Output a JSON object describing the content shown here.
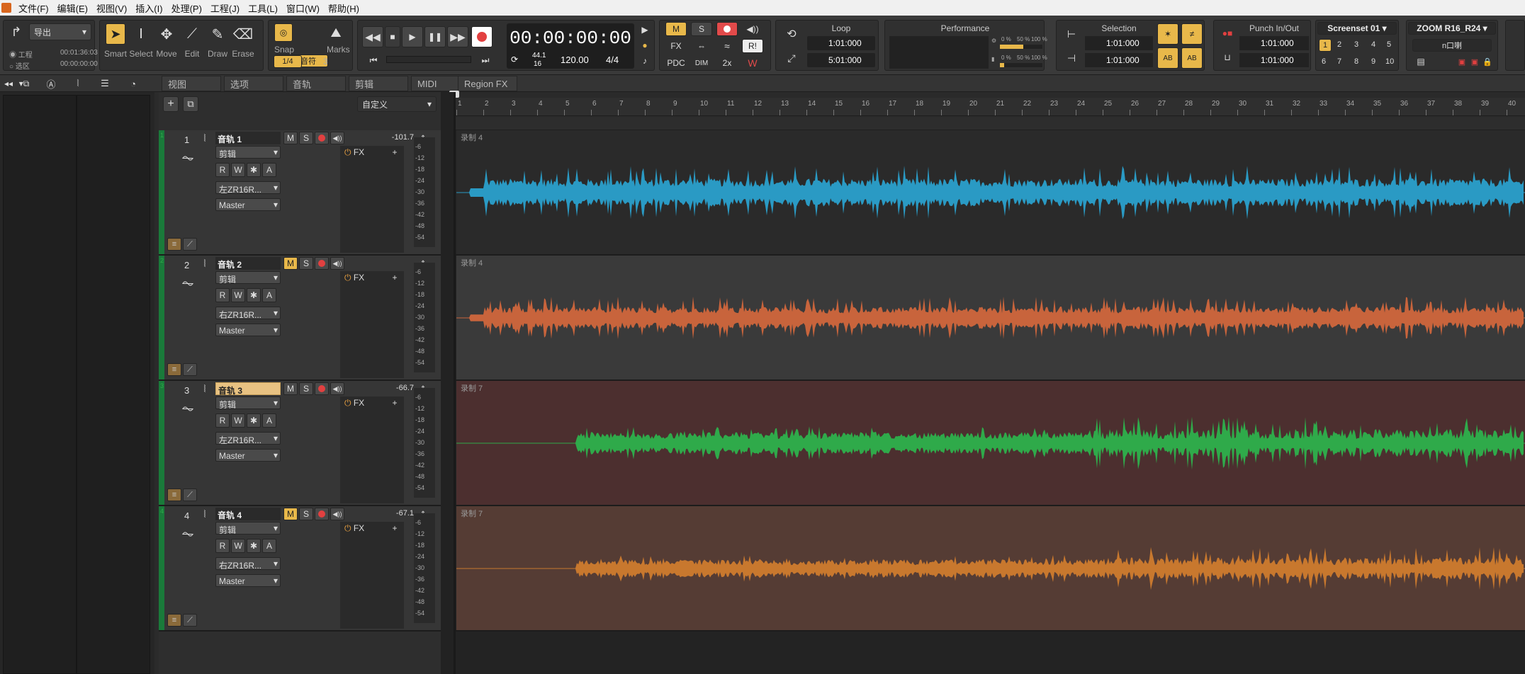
{
  "menu": [
    "文件(F)",
    "编辑(E)",
    "视图(V)",
    "插入(I)",
    "处理(P)",
    "工程(J)",
    "工具(L)",
    "窗口(W)",
    "帮助(H)"
  ],
  "export": {
    "label": "导出",
    "project_label": "工程",
    "region_label": "选区",
    "time1": "00:01:36:03",
    "time2": "00:00:00:00"
  },
  "tools": [
    {
      "label": "Smart",
      "icon": "arrow-icon"
    },
    {
      "label": "Select",
      "icon": "ibeam-icon"
    },
    {
      "label": "Move",
      "icon": "move-icon"
    },
    {
      "label": "Edit",
      "icon": "edit-icon"
    },
    {
      "label": "Draw",
      "icon": "pencil-icon"
    },
    {
      "label": "Erase",
      "icon": "eraser-icon"
    }
  ],
  "snap": {
    "label": "Snap",
    "value": "4 分音符",
    "quant": "1/4",
    "n": "3",
    "marks": "Marks"
  },
  "transport": {
    "time": "00:00:00:00",
    "rate": "44.1",
    "bits": "16",
    "tempo": "120.00",
    "meter": "4/4"
  },
  "mix": {
    "m": "M",
    "s": "S",
    "fx": "FX",
    "ri": "R!",
    "pdc": "PDC",
    "dim": "DIM",
    "x2": "2x"
  },
  "loop": {
    "title": "Loop",
    "start": "1:01:000",
    "end": "5:01:000"
  },
  "performance": {
    "title": "Performance",
    "p1": "0 %",
    "p2": "50 %",
    "p3": "100 %"
  },
  "selection": {
    "title": "Selection",
    "start": "1:01:000",
    "end": "1:01:000"
  },
  "punch": {
    "title": "Punch In/Out",
    "start": "1:01:000",
    "end": "1:01:000"
  },
  "screenset": {
    "title": "Screenset 01",
    "nums": [
      "1",
      "2",
      "3",
      "4",
      "5",
      "6",
      "7",
      "8",
      "9",
      "10"
    ]
  },
  "device": {
    "title": "ZOOM R16_R24",
    "sub": "n口喇"
  },
  "tabs": [
    "视图",
    "选项",
    "音轨",
    "剪辑",
    "MIDI",
    "Region FX"
  ],
  "preset": "自定义",
  "meter_marks": [
    "-6",
    "-12",
    "-18",
    "-24",
    "-30",
    "-36",
    "-42",
    "-48",
    "-54"
  ],
  "ruler": [
    "1",
    "2",
    "3",
    "4",
    "5",
    "6",
    "7",
    "8",
    "9",
    "10",
    "11",
    "12",
    "13",
    "14",
    "15",
    "16",
    "17",
    "18",
    "19",
    "20",
    "21",
    "22",
    "23",
    "24",
    "25",
    "26",
    "27",
    "28",
    "29",
    "30",
    "31",
    "32",
    "33",
    "34",
    "35",
    "36",
    "37",
    "38",
    "39",
    "40"
  ],
  "colors": {
    "track1": "#2a9ac4",
    "track2": "#c8643c",
    "track3": "#2faa4a",
    "track4": "#c8782e",
    "bg1": "#2a2a2a",
    "bg2": "#3a3a3a",
    "bg3": "#4c2f2f",
    "bg4": "#553c34"
  },
  "tracks": [
    {
      "num": "1",
      "name": "音轨 1",
      "clip": "剪辑",
      "input": "左ZR16R...",
      "out": "Master",
      "fx": "FX",
      "vol": "-101.7",
      "clipname": "录制 4",
      "mute_on": false,
      "sel": false
    },
    {
      "num": "2",
      "name": "音轨 2",
      "clip": "剪辑",
      "input": "右ZR16R...",
      "out": "Master",
      "fx": "FX",
      "vol": "",
      "clipname": "录制 4",
      "mute_on": true,
      "sel": false
    },
    {
      "num": "3",
      "name": "音轨 3",
      "clip": "剪辑",
      "input": "左ZR16R...",
      "out": "Master",
      "fx": "FX",
      "vol": "-66.7",
      "clipname": "录制 7",
      "mute_on": false,
      "sel": true
    },
    {
      "num": "4",
      "name": "音轨 4",
      "clip": "剪辑",
      "input": "右ZR16R...",
      "out": "Master",
      "fx": "FX",
      "vol": "-67.1",
      "clipname": "录制 7",
      "mute_on": true,
      "sel": false
    }
  ]
}
